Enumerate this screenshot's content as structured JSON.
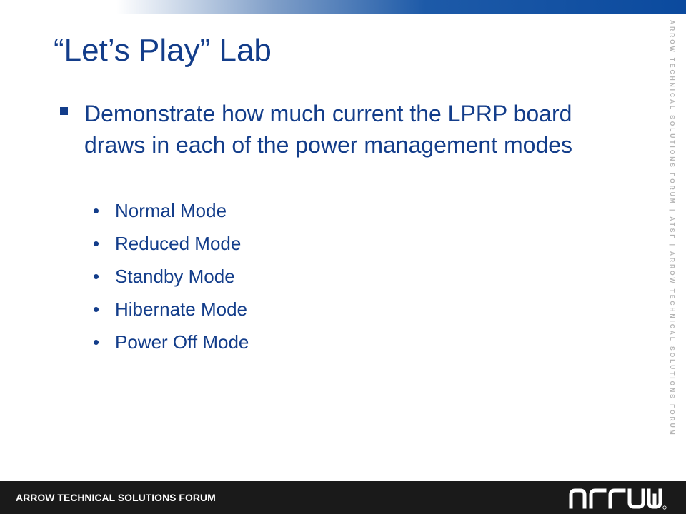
{
  "header": {
    "accent_color": "#0b4a9e"
  },
  "side_banner": {
    "text": "ARROW TECHNICAL SOLUTIONS FORUM | ATSF | ARROW TECHNICAL SOLUTIONS FORUM"
  },
  "slide": {
    "title": "“Let’s Play” Lab",
    "text_color": "#133d8a",
    "main_bullet": "Demonstrate how much current the LPRP board draws in each of the power management modes",
    "sub_bullet_glyph": "•",
    "sub_bullets": [
      "Normal Mode",
      "Reduced Mode",
      "Standby Mode",
      "Hibernate Mode",
      "Power Off Mode"
    ]
  },
  "footer": {
    "forum_name": "ARROW TECHNICAL SOLUTIONS FORUM",
    "logo_text": "ARROW",
    "logo_icon": "arrow-logo",
    "background_color": "#1a1a1a"
  }
}
